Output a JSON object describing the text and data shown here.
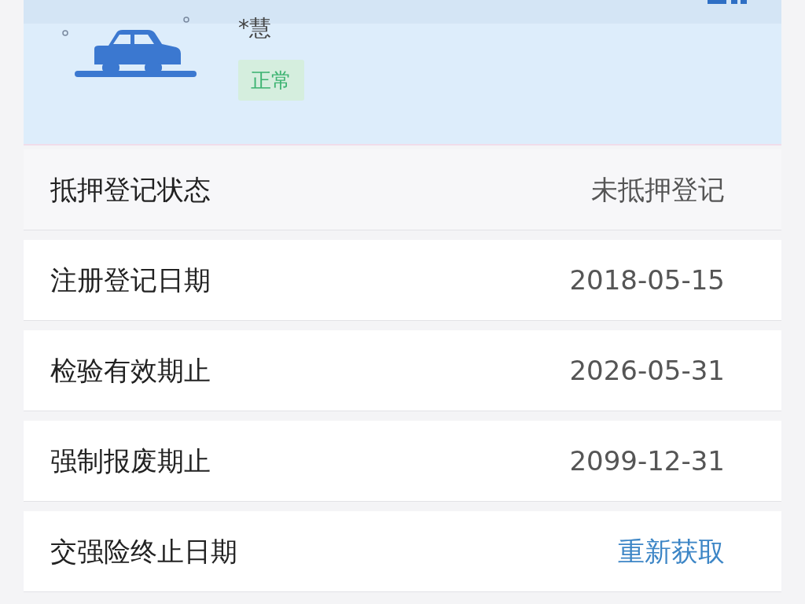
{
  "vehicle": {
    "owner": "*慧",
    "status": {
      "label": "正常",
      "color": "#3cb371"
    }
  },
  "rows": [
    {
      "label": "抵押登记状态",
      "value": "未抵押登记",
      "kind": "text"
    },
    {
      "label": "注册登记日期",
      "value": "2018-05-15",
      "kind": "text"
    },
    {
      "label": "检验有效期止",
      "value": "2026-05-31",
      "kind": "text"
    },
    {
      "label": "强制报废期止",
      "value": "2099-12-31",
      "kind": "text"
    },
    {
      "label": "交强险终止日期",
      "value": "重新获取",
      "kind": "link"
    }
  ]
}
